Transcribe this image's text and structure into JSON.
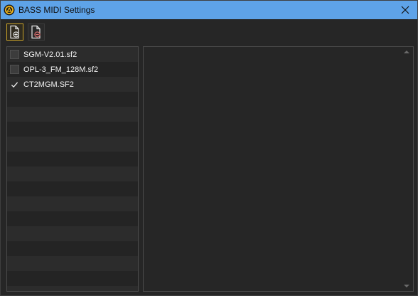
{
  "window": {
    "title": "BASS MIDI Settings"
  },
  "toolbar": {
    "add_icon": "add-soundfont-icon",
    "remove_icon": "remove-soundfont-icon"
  },
  "soundfonts": [
    {
      "label": "SGM-V2.01.sf2",
      "checked": false
    },
    {
      "label": "OPL-3_FM_128M.sf2",
      "checked": false
    },
    {
      "label": "CT2MGM.SF2",
      "checked": true
    }
  ],
  "colors": {
    "titlebar": "#5ea3e8",
    "background": "#262626",
    "accent": "#c9a227"
  }
}
